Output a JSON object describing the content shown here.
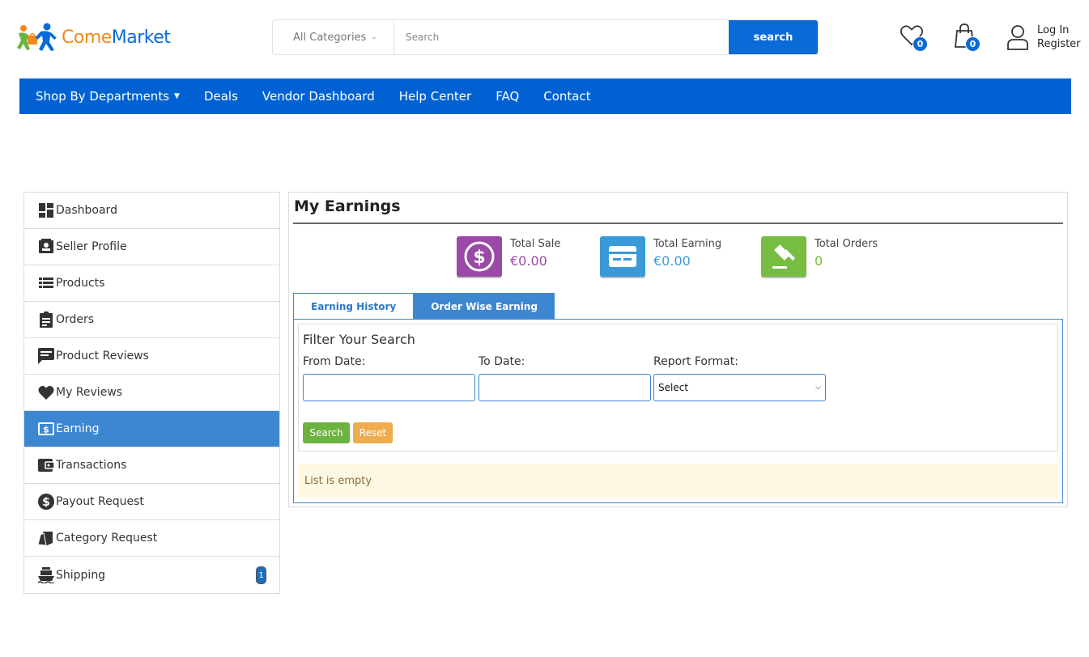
{
  "header": {
    "logo": {
      "text_part1": "Come",
      "text_part2": "Market",
      "icon": "people-bag-logo-icon"
    },
    "search": {
      "category_label": "All Categories",
      "placeholder": "Search",
      "button_label": "search"
    },
    "wishlist": {
      "icon": "heart-icon",
      "count": "0"
    },
    "cart": {
      "icon": "shopping-bag-icon",
      "count": "0"
    },
    "account": {
      "icon": "user-icon",
      "login": "Log In",
      "register": "Register"
    }
  },
  "nav": {
    "items": [
      {
        "label": "Shop By Departments",
        "has_dropdown": true
      },
      {
        "label": "Deals"
      },
      {
        "label": "Vendor Dashboard"
      },
      {
        "label": "Help Center"
      },
      {
        "label": "FAQ"
      },
      {
        "label": "Contact"
      }
    ]
  },
  "sidebar": {
    "items": [
      {
        "label": "Dashboard",
        "icon": "dashboard-icon"
      },
      {
        "label": "Seller Profile",
        "icon": "contact-card-icon"
      },
      {
        "label": "Products",
        "icon": "list-icon"
      },
      {
        "label": "Orders",
        "icon": "clipboard-icon"
      },
      {
        "label": "Product Reviews",
        "icon": "comment-icon"
      },
      {
        "label": "My Reviews",
        "icon": "heart-icon"
      },
      {
        "label": "Earning",
        "icon": "money-icon",
        "active": true
      },
      {
        "label": "Transactions",
        "icon": "wallet-icon"
      },
      {
        "label": "Payout Request",
        "icon": "dollar-circle-icon"
      },
      {
        "label": "Category Request",
        "icon": "tags-icon"
      },
      {
        "label": "Shipping",
        "icon": "ship-icon",
        "badge": "1"
      }
    ]
  },
  "main": {
    "title": "My Earnings",
    "stats": [
      {
        "label": "Total Sale",
        "value": "€0.00",
        "icon": "dollar-circle-icon",
        "color": "#9a4aa6"
      },
      {
        "label": "Total Earning",
        "value": "€0.00",
        "icon": "credit-card-icon",
        "color": "#3a9ad9"
      },
      {
        "label": "Total Orders",
        "value": "0",
        "icon": "gavel-icon",
        "color": "#76bd42"
      }
    ],
    "tabs": [
      {
        "label": "Earning History",
        "active": true
      },
      {
        "label": "Order Wise Earning",
        "active": false
      }
    ],
    "filter": {
      "title": "Filter Your Search",
      "from_label": "From Date:",
      "to_label": "To Date:",
      "format_label": "Report Format:",
      "format_value": "Select",
      "search_button": "Search",
      "reset_button": "Reset"
    },
    "empty_message": "List is empty"
  },
  "colors": {
    "primary": "#0a6ad6",
    "nav_bg": "#0062d2",
    "active_item": "#3d87d0",
    "logo_orange": "#f08a1c"
  }
}
